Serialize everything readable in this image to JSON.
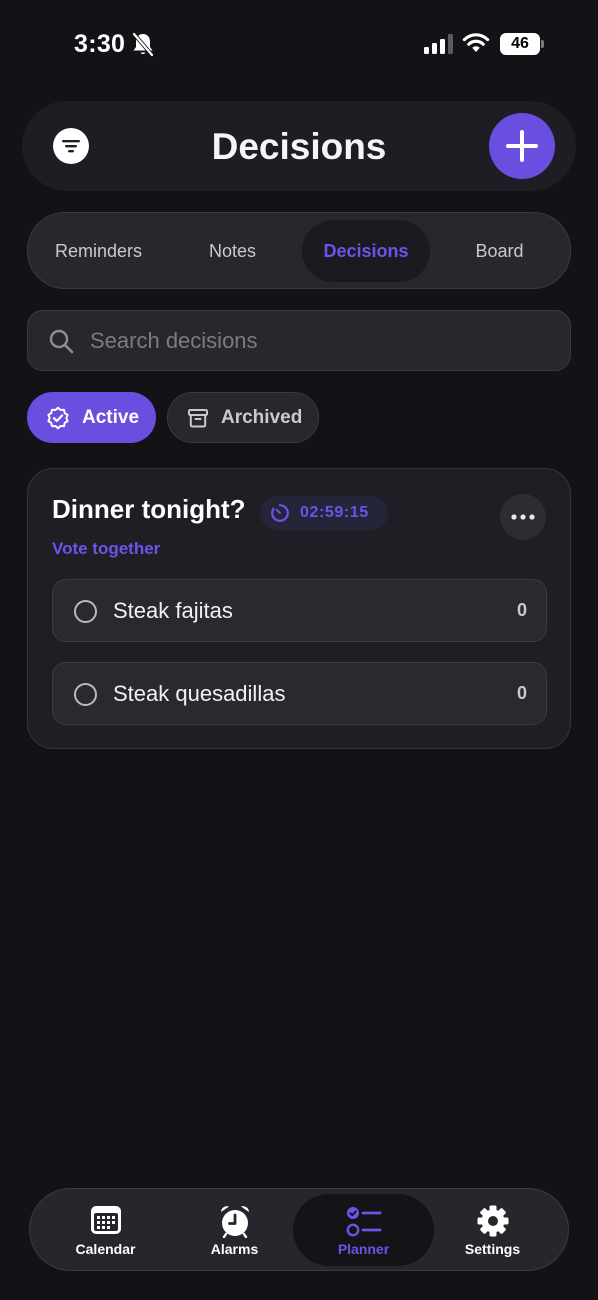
{
  "status_bar": {
    "time": "3:30",
    "battery": "46"
  },
  "header": {
    "title": "Decisions"
  },
  "segments": [
    {
      "label": "Reminders"
    },
    {
      "label": "Notes"
    },
    {
      "label": "Decisions"
    },
    {
      "label": "Board"
    }
  ],
  "active_segment": "Decisions",
  "search": {
    "placeholder": "Search decisions",
    "value": ""
  },
  "filters": {
    "active_label": "Active",
    "archived_label": "Archived",
    "selected": "Active"
  },
  "decision": {
    "title": "Dinner tonight?",
    "timer": "02:59:15",
    "subtitle": "Vote together",
    "options": [
      {
        "label": "Steak fajitas",
        "count": "0"
      },
      {
        "label": "Steak quesadillas",
        "count": "0"
      }
    ]
  },
  "tabbar": {
    "tabs": [
      {
        "label": "Calendar",
        "icon": "calendar-icon"
      },
      {
        "label": "Alarms",
        "icon": "alarm-clock-icon"
      },
      {
        "label": "Planner",
        "icon": "planner-checklist-icon"
      },
      {
        "label": "Settings",
        "icon": "gear-icon"
      }
    ],
    "active": "Planner"
  },
  "colors": {
    "accent": "#6a4ee0",
    "accent_text": "#6f52e8",
    "background": "#131317",
    "card": "#1e1e24"
  }
}
